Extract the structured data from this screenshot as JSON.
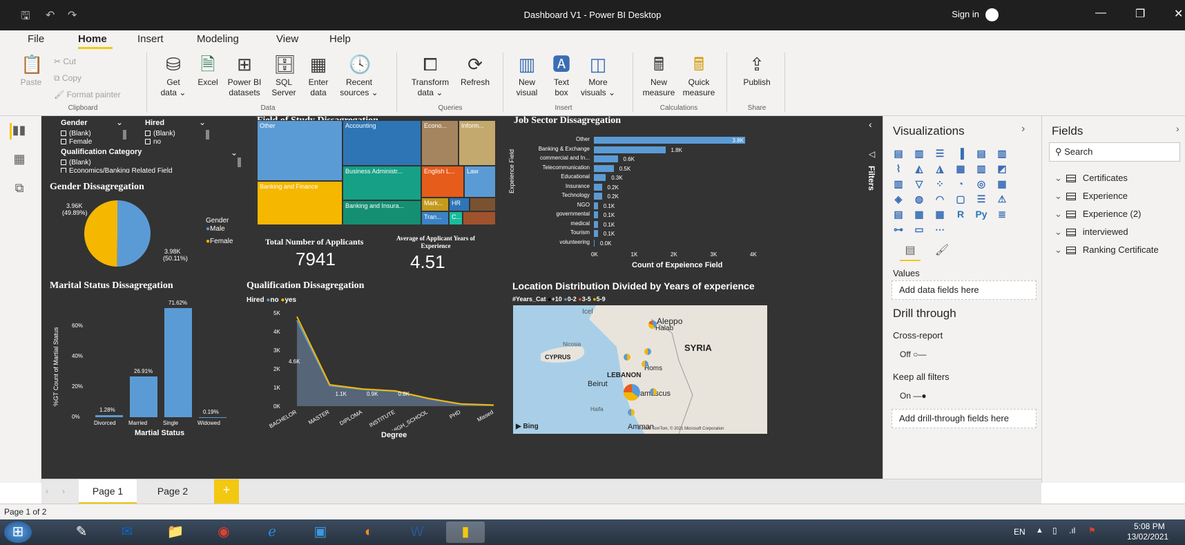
{
  "window": {
    "title": "Dashboard V1 - Power BI Desktop",
    "sign_in": "Sign in"
  },
  "menu": [
    "File",
    "Home",
    "Insert",
    "Modeling",
    "View",
    "Help"
  ],
  "ribbon": {
    "clipboard": {
      "paste": "Paste",
      "cut": "Cut",
      "copy": "Copy",
      "format_painter": "Format painter",
      "group": "Clipboard"
    },
    "data": {
      "get_data": [
        "Get",
        "data ⌄"
      ],
      "excel": "Excel",
      "pbi_datasets": [
        "Power BI",
        "datasets"
      ],
      "sql": [
        "SQL",
        "Server"
      ],
      "enter_data": [
        "Enter",
        "data"
      ],
      "recent": [
        "Recent",
        "sources ⌄"
      ],
      "group": "Data"
    },
    "queries": {
      "transform": [
        "Transform",
        "data ⌄"
      ],
      "refresh": "Refresh",
      "group": "Queries"
    },
    "insert": {
      "new_visual": [
        "New",
        "visual"
      ],
      "text_box": [
        "Text",
        "box"
      ],
      "more_visuals": [
        "More",
        "visuals ⌄"
      ],
      "group": "Insert"
    },
    "calculations": {
      "new_measure": [
        "New",
        "measure"
      ],
      "quick_measure": [
        "Quick",
        "measure"
      ],
      "group": "Calculations"
    },
    "share": {
      "publish": "Publish",
      "group": "Share"
    }
  },
  "slicers": {
    "gender": {
      "label": "Gender",
      "options": [
        "(Blank)",
        "Female"
      ]
    },
    "hired": {
      "label": "Hired",
      "options": [
        "(Blank)",
        "no"
      ]
    },
    "qualification": {
      "label": "Qualification Category",
      "options": [
        "(Blank)",
        "Economics/Banking Related Field"
      ]
    }
  },
  "gender_chart": {
    "title": "Gender Dissagregation",
    "legend_title": "Gender",
    "legend": [
      "Male",
      "Female"
    ],
    "label_female": [
      "3.96K",
      "(49.89%)"
    ],
    "label_male": [
      "3.98K",
      "(50.11%)"
    ],
    "colors": {
      "male": "#5b9bd5",
      "female": "#f5b700"
    }
  },
  "field_of_study": {
    "title": "Field of Study Dissagregation",
    "tiles": [
      "Other",
      "Accounting",
      "Econo...",
      "Inform...",
      "Business Administr...",
      "English L...",
      "Law",
      "Banking and Finance",
      "Banking and Insura...",
      "Mark...",
      "HR",
      "C...",
      "Tran..."
    ]
  },
  "kpis": {
    "total_label": "Total Number of Applicants",
    "total_value": "7941",
    "avg_label": "Average of Applicant Years of Experience",
    "avg_value": "4.51"
  },
  "job_sector": {
    "title": "Job Sector Dissagregation",
    "axis_y": "Expeience Field",
    "axis_x": "Count of Expeience Field",
    "ticks": [
      "0K",
      "1K",
      "2K",
      "3K",
      "4K"
    ]
  },
  "marital": {
    "title": "Marital Status Dissagregation",
    "axis_y": "%GT Count of Martial Status",
    "axis_x": "Martial Status",
    "yticks": [
      "0%",
      "20%",
      "40%",
      "60%"
    ]
  },
  "qualification_chart": {
    "title": "Qualification Dissagregation",
    "legend_title": "Hired",
    "legend": [
      "no",
      "yes"
    ],
    "axis_x": "Degree",
    "yticks": [
      "0K",
      "1K",
      "2K",
      "3K",
      "4K",
      "5K"
    ],
    "value_labels": [
      "4.6K",
      "1.1K",
      "0.9K",
      "0.8K"
    ]
  },
  "location_map": {
    "title": "Location Distribution Divided by Years of experience",
    "legend_title": "#Years_Cat",
    "legend": [
      "+10",
      "0-2",
      "3-5",
      "5-9"
    ],
    "places": [
      "Aleppo",
      "Halab",
      "SYRIA",
      "CYPRUS",
      "LEBANON",
      "Beirut",
      "Damascus",
      "Homs",
      "Amman",
      "Icel",
      "Nicosia",
      "Haifa"
    ],
    "attribution": "© 2021 TomTom, © 2021 Microsoft Corporation",
    "bing": "Bing"
  },
  "visualizations_pane": {
    "title": "Visualizations",
    "values_label": "Values",
    "values_placeholder": "Add data fields here",
    "drill_title": "Drill through",
    "cross_report": "Cross-report",
    "cross_state": "Off",
    "keep_filters": "Keep all filters",
    "keep_state": "On",
    "drill_placeholder": "Add drill-through fields here"
  },
  "filters_label": "Filters",
  "fields_pane": {
    "title": "Fields",
    "search_placeholder": "Search",
    "tables": [
      "Certificates",
      "Experience",
      "Experience (2)",
      "interviewed",
      "Ranking Certificate"
    ]
  },
  "pages": [
    "Page 1",
    "Page 2"
  ],
  "status": "Page 1 of 2",
  "taskbar": {
    "lang": "EN",
    "time": "5:08 PM",
    "date": "13/02/2021"
  },
  "chart_data": [
    {
      "type": "pie",
      "title": "Gender Dissagregation",
      "categories": [
        "Male",
        "Female"
      ],
      "values": [
        3980,
        3960
      ],
      "percent": [
        50.11,
        49.89
      ]
    },
    {
      "type": "bar",
      "orientation": "horizontal",
      "title": "Job Sector Dissagregation",
      "categories": [
        "Other",
        "Banking & Exchange",
        "commercial and In...",
        "Telecommunication",
        "Educational",
        "Insurance",
        "Technology",
        "NGO",
        "governmental",
        "medical",
        "Tourism",
        "volunteering"
      ],
      "values": [
        3.8,
        1.8,
        0.6,
        0.5,
        0.3,
        0.2,
        0.2,
        0.1,
        0.1,
        0.1,
        0.1,
        0.0
      ],
      "value_labels": [
        "3.8K",
        "1.8K",
        "0.6K",
        "0.5K",
        "0.3K",
        "0.2K",
        "0.2K",
        "0.1K",
        "0.1K",
        "0.1K",
        "0.1K",
        "0.0K"
      ],
      "unit": "K",
      "xlim": [
        0,
        4
      ],
      "xlabel": "Count of Expeience Field",
      "ylabel": "Expeience Field"
    },
    {
      "type": "bar",
      "title": "Marital Status Dissagregation",
      "categories": [
        "Divorced",
        "Married",
        "Single",
        "Widowed"
      ],
      "values": [
        1.28,
        26.91,
        71.62,
        0.19
      ],
      "value_labels": [
        "1.28%",
        "26.91%",
        "71.62%",
        "0.19%"
      ],
      "ylim": [
        0,
        80
      ],
      "xlabel": "Martial Status",
      "ylabel": "%GT Count of Martial Status"
    },
    {
      "type": "area",
      "title": "Qualification Dissagregation",
      "categories": [
        "BACHELOR",
        "MASTER",
        "DIPLOMA",
        "INSTITUTE",
        "HIGH_SCHOOL",
        "PHD",
        "Missed"
      ],
      "series": [
        {
          "name": "no",
          "values": [
            4.6,
            1.1,
            0.9,
            0.8,
            0.4,
            0.1,
            0.05
          ]
        },
        {
          "name": "yes",
          "values": [
            4.8,
            1.15,
            0.92,
            0.82,
            0.42,
            0.12,
            0.06
          ]
        }
      ],
      "ylim": [
        0,
        5
      ],
      "xlabel": "Degree"
    }
  ]
}
